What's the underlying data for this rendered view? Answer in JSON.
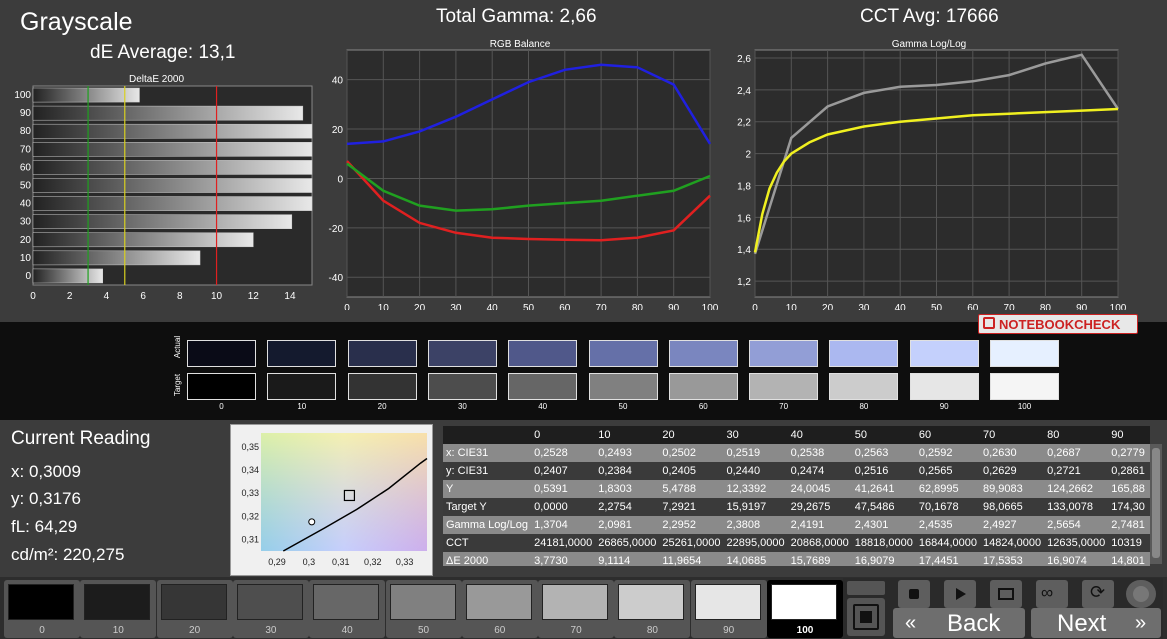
{
  "header": {
    "title": "Grayscale",
    "de_average": "dE Average: 13,1",
    "total_gamma": "Total Gamma: 2,66",
    "cct_avg": "CCT Avg: 17666"
  },
  "brand": {
    "logo_text": "NOTEBOOKCHECK"
  },
  "chart_data": [
    {
      "type": "bar",
      "title": "DeltaE 2000",
      "orientation": "horizontal",
      "categories": [
        "100",
        "90",
        "80",
        "70",
        "60",
        "50",
        "40",
        "30",
        "20",
        "10",
        "0"
      ],
      "values": [
        5.8,
        14.7,
        15.2,
        15.2,
        15.2,
        15.2,
        15.2,
        14.1,
        12.0,
        9.1,
        3.8
      ],
      "x_ticks": [
        "0",
        "2",
        "4",
        "6",
        "8",
        "10",
        "12",
        "14"
      ],
      "xlim": [
        0,
        15.2
      ],
      "reference_lines": [
        {
          "value": 3,
          "color": "#1ea01e"
        },
        {
          "value": 5,
          "color": "#d8d020"
        },
        {
          "value": 10,
          "color": "#e02020"
        }
      ]
    },
    {
      "type": "line",
      "title": "RGB Balance",
      "x": [
        0,
        10,
        20,
        30,
        40,
        50,
        60,
        70,
        80,
        90,
        100
      ],
      "x_ticks": [
        "0",
        "10",
        "20",
        "30",
        "40",
        "50",
        "60",
        "70",
        "80",
        "90",
        "100"
      ],
      "y_ticks": [
        "40",
        "20",
        "0",
        "-20",
        "-40"
      ],
      "xlim": [
        0,
        100
      ],
      "ylim": [
        -48,
        52
      ],
      "grid": true,
      "series": [
        {
          "color": "#2020e0",
          "values": [
            14,
            15,
            19,
            25,
            32,
            39,
            44,
            46,
            45,
            38,
            14
          ]
        },
        {
          "color": "#e02020",
          "values": [
            7,
            -9,
            -18,
            -22,
            -24,
            -24.5,
            -24.8,
            -25,
            -24,
            -21,
            -7
          ]
        },
        {
          "color": "#20a020",
          "values": [
            6,
            -5,
            -11,
            -13,
            -12.5,
            -11,
            -10,
            -9,
            -7,
            -5,
            1
          ]
        }
      ]
    },
    {
      "type": "line",
      "title": "Gamma Log/Log",
      "x": [
        0,
        10,
        20,
        30,
        40,
        50,
        60,
        70,
        80,
        90,
        100
      ],
      "x_ticks": [
        "0",
        "10",
        "20",
        "30",
        "40",
        "50",
        "60",
        "70",
        "80",
        "90",
        "100"
      ],
      "y_ticks": [
        "2,6",
        "2,4",
        "2,2",
        "2",
        "1,8",
        "1,6",
        "1,4",
        "1,2"
      ],
      "xlim": [
        0,
        100
      ],
      "ylim": [
        1.1,
        2.65
      ],
      "grid": true,
      "series": [
        {
          "color": "#9a9a9a",
          "x": [
            0,
            10,
            20,
            30,
            40,
            50,
            60,
            70,
            80,
            90,
            100
          ],
          "values": [
            1.3704,
            2.0981,
            2.2952,
            2.3808,
            2.4191,
            2.4301,
            2.4535,
            2.4927,
            2.5654,
            2.62,
            2.28
          ]
        },
        {
          "color": "#f0f020",
          "x": [
            0,
            2,
            4,
            6,
            8,
            10,
            15,
            20,
            30,
            40,
            50,
            60,
            70,
            80,
            90,
            100
          ],
          "values": [
            1.38,
            1.62,
            1.78,
            1.88,
            1.95,
            2.0,
            2.07,
            2.12,
            2.17,
            2.2,
            2.22,
            2.24,
            2.25,
            2.26,
            2.27,
            2.28
          ]
        }
      ]
    },
    {
      "type": "scatter",
      "title": "",
      "x_ticks": [
        "0,29",
        "0,3",
        "0,31",
        "0,32",
        "0,33"
      ],
      "y_ticks": [
        "0,35",
        "0,34",
        "0,33",
        "0,32",
        "0,31"
      ],
      "xlim": [
        0.285,
        0.337
      ],
      "ylim": [
        0.305,
        0.356
      ],
      "points": [
        {
          "name": "target",
          "x": 0.3127,
          "y": 0.329,
          "marker": "square"
        },
        {
          "name": "actual",
          "x": 0.3009,
          "y": 0.3176,
          "marker": "circle"
        }
      ],
      "locus": [
        [
          0.292,
          0.305
        ],
        [
          0.305,
          0.315
        ],
        [
          0.315,
          0.323
        ],
        [
          0.325,
          0.332
        ],
        [
          0.335,
          0.343
        ],
        [
          0.337,
          0.345
        ]
      ]
    }
  ],
  "swatches": {
    "row_actual_label": "Actual",
    "row_target_label": "Target",
    "labels": [
      "0",
      "10",
      "20",
      "30",
      "40",
      "50",
      "60",
      "70",
      "80",
      "90",
      "100"
    ],
    "actual_colors": [
      "#0a0b17",
      "#141a2e",
      "#292f4c",
      "#3c4266",
      "#50588a",
      "#6570a8",
      "#7a86bf",
      "#929ed6",
      "#abb8f0",
      "#c4d0fc",
      "#e6f0ff"
    ],
    "target_colors": [
      "#000000",
      "#1a1a1a",
      "#333333",
      "#4d4d4d",
      "#666666",
      "#808080",
      "#999999",
      "#b3b3b3",
      "#cccccc",
      "#e6e6e6",
      "#f5f5f5"
    ]
  },
  "reading": {
    "title": "Current Reading",
    "x": "x: 0,3009",
    "y": "y: 0,3176",
    "fl": "fL: 64,29",
    "cdm2": "cd/m²: 220,275"
  },
  "table": {
    "headers": [
      "",
      "0",
      "10",
      "20",
      "30",
      "40",
      "50",
      "60",
      "70",
      "80",
      "90"
    ],
    "rows": [
      {
        "label": "x: CIE31",
        "values": [
          "0,2528",
          "0,2493",
          "0,2502",
          "0,2519",
          "0,2538",
          "0,2563",
          "0,2592",
          "0,2630",
          "0,2687",
          "0,2779"
        ]
      },
      {
        "label": "y: CIE31",
        "values": [
          "0,2407",
          "0,2384",
          "0,2405",
          "0,2440",
          "0,2474",
          "0,2516",
          "0,2565",
          "0,2629",
          "0,2721",
          "0,2861"
        ]
      },
      {
        "label": "Y",
        "values": [
          "0,5391",
          "1,8303",
          "5,4788",
          "12,3392",
          "24,0045",
          "41,2641",
          "62,8995",
          "89,9083",
          "124,2662",
          "165,88"
        ]
      },
      {
        "label": "Target Y",
        "values": [
          "0,0000",
          "2,2754",
          "7,2921",
          "15,9197",
          "29,2675",
          "47,5486",
          "70,1678",
          "98,0665",
          "133,0078",
          "174,30"
        ]
      },
      {
        "label": "Gamma Log/Log",
        "values": [
          "1,3704",
          "2,0981",
          "2,2952",
          "2,3808",
          "2,4191",
          "2,4301",
          "2,4535",
          "2,4927",
          "2,5654",
          "2,7481"
        ]
      },
      {
        "label": "CCT",
        "values": [
          "24181,0000",
          "26865,0000",
          "25261,0000",
          "22895,0000",
          "20868,0000",
          "18818,0000",
          "16844,0000",
          "14824,0000",
          "12635,0000",
          "10319"
        ]
      },
      {
        "label": "ΔE 2000",
        "values": [
          "3,7730",
          "9,1114",
          "11,9654",
          "14,0685",
          "15,7689",
          "16,9079",
          "17,4451",
          "17,5353",
          "16,9074",
          "14,801"
        ]
      }
    ]
  },
  "patches": {
    "labels": [
      "0",
      "10",
      "20",
      "30",
      "40",
      "50",
      "60",
      "70",
      "80",
      "90",
      "100"
    ],
    "colors": [
      "#000000",
      "#1c1c1c",
      "#363636",
      "#4e4e4e",
      "#676767",
      "#808080",
      "#999999",
      "#b3b3b3",
      "#cccccc",
      "#e6e6e6",
      "#ffffff"
    ],
    "active_index": 10
  },
  "controls": {
    "back_label": "Back",
    "next_label": "Next",
    "icons": [
      "stop-icon",
      "play-icon",
      "single-measure-icon",
      "loop-icon",
      "refresh-icon",
      "record-icon"
    ]
  }
}
